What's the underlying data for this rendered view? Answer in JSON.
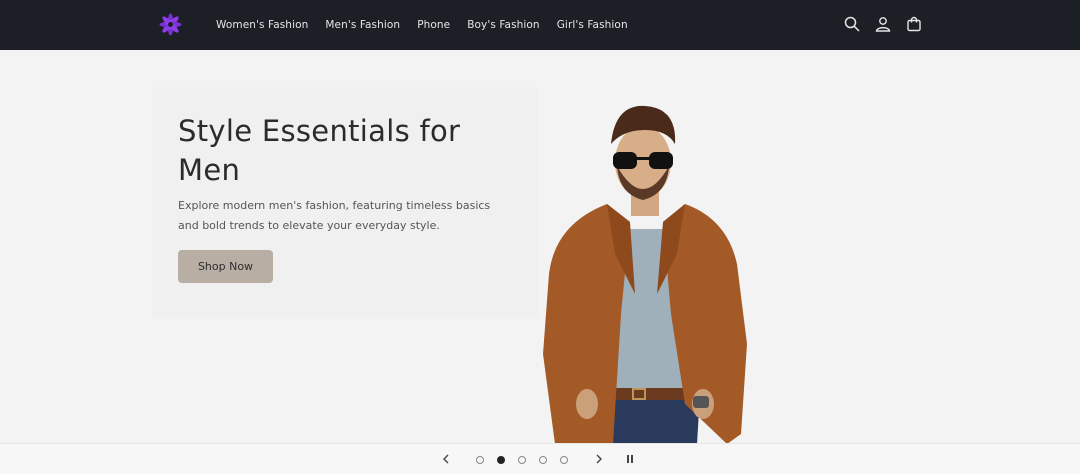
{
  "nav": {
    "items": [
      {
        "label": "Women's Fashion"
      },
      {
        "label": "Men's Fashion"
      },
      {
        "label": "Phone"
      },
      {
        "label": "Boy's Fashion"
      },
      {
        "label": "Girl's Fashion"
      }
    ]
  },
  "header_icons": [
    "search-icon",
    "account-icon",
    "cart-icon"
  ],
  "hero": {
    "title": "Style Essentials for Men",
    "description": "Explore modern men's fashion, featuring timeless basics and bold trends to elevate your everyday style.",
    "button_label": "Shop Now"
  },
  "slider": {
    "total_slides": 5,
    "active_index": 1,
    "controls": [
      "chevron-left-icon",
      "chevron-right-icon",
      "pause-icon"
    ]
  },
  "colors": {
    "header_bg": "#1c1f26",
    "accent_logo": "#7b2fd6",
    "button_bg": "#b8aea4",
    "page_bg": "#f3f3f3"
  }
}
